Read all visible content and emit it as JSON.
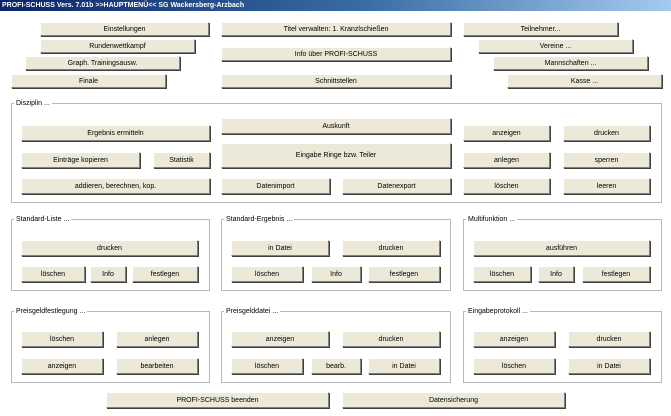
{
  "window": {
    "title": "PROFI-SCHUSS Vers. 7.01b   >>HAUPTMENÜ<<  SG Wackersberg-Arzbach"
  },
  "top": {
    "einstellungen": "Einstellungen",
    "rundenwettkampf": "Rundenwettkampf",
    "graph_training": "Graph. Trainingsausw.",
    "finale": "Finale",
    "titel_verwalten": "Titel verwalten: 1. Kranzlschießen",
    "info_profi": "Info über PROFI-SCHUSS",
    "schnittstellen": "Schnittstellen",
    "teilnehmer": "Teilnehmer...",
    "vereine": "Vereine ...",
    "mannschaften": "Mannschaften ...",
    "kasse": "Kasse ..."
  },
  "disziplin": {
    "label": "Disziplin ...",
    "ergebnis_ermitteln": "Ergebnis ermitteln",
    "eintraege_kopieren": "Einträge kopieren",
    "statistik": "Statistik",
    "addieren": "addieren, berechnen, kop.",
    "auskunft": "Auskunft",
    "eingabe_ringe": "Eingabe Ringe bzw. Teiler",
    "datenimport": "Datenimport",
    "datenexport": "Datenexport",
    "anzeigen": "anzeigen",
    "drucken": "drucken",
    "anlegen": "anlegen",
    "sperren": "sperren",
    "loeschen": "löschen",
    "leeren": "leeren"
  },
  "standard_liste": {
    "label": "Standard-Liste ...",
    "drucken": "drucken",
    "loeschen": "löschen",
    "info": "Info",
    "festlegen": "festlegen"
  },
  "standard_ergebnis": {
    "label": "Standard-Ergebnis ...",
    "in_datei": "in Datei",
    "drucken": "drucken",
    "loeschen": "löschen",
    "info": "Info",
    "festlegen": "festlegen"
  },
  "multifunktion": {
    "label": "Multifunktion ...",
    "ausfuehren": "ausführen",
    "loeschen": "löschen",
    "info": "Info",
    "festlegen": "festlegen"
  },
  "preisgeldfestlegung": {
    "label": "Preisgeldfestlegung ...",
    "loeschen": "löschen",
    "anlegen": "anlegen",
    "anzeigen": "anzeigen",
    "bearbeiten": "bearbeiten"
  },
  "preisgelddatei": {
    "label": "Preisgelddatei ...",
    "anzeigen": "anzeigen",
    "drucken": "drucken",
    "loeschen": "löschen",
    "bearb": "bearb.",
    "in_datei": "in Datei"
  },
  "eingabeprotokoll": {
    "label": "Eingabeprotokoll ...",
    "anzeigen": "anzeigen",
    "drucken": "drucken",
    "loeschen": "löschen",
    "in_datei": "in Datei"
  },
  "bottom": {
    "beenden": "PROFI-SCHUSS beenden",
    "datensicherung": "Datensicherung"
  }
}
